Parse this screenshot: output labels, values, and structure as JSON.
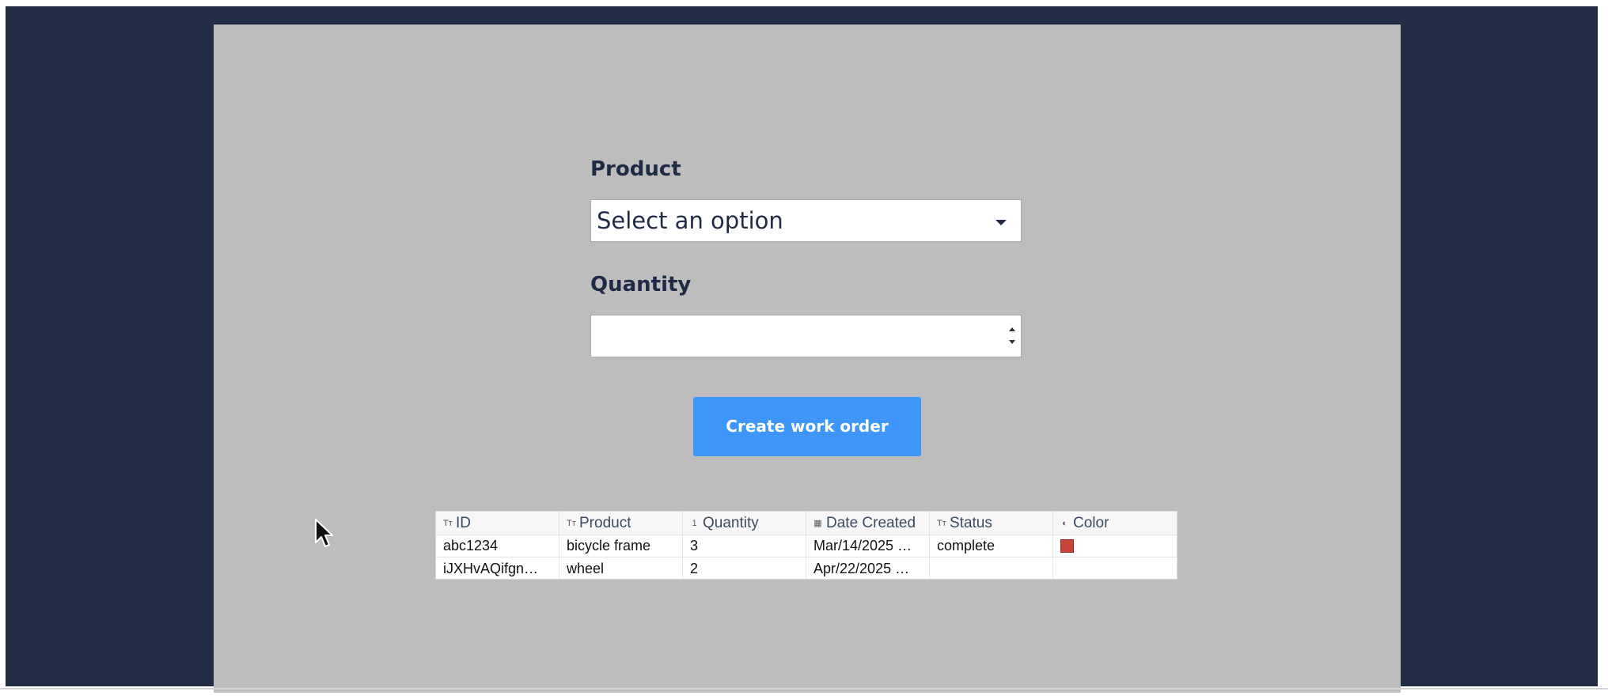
{
  "form": {
    "product_label": "Product",
    "product_select_value": "Select an option",
    "quantity_label": "Quantity",
    "quantity_value": "",
    "submit_label": "Create work order"
  },
  "table": {
    "columns": [
      {
        "label": "ID",
        "icon": "text-type-icon",
        "glyph": "Tт"
      },
      {
        "label": "Product",
        "icon": "text-type-icon",
        "glyph": "Tт"
      },
      {
        "label": "Quantity",
        "icon": "number-type-icon",
        "glyph": "1"
      },
      {
        "label": "Date Created",
        "icon": "calendar-type-icon",
        "glyph": "▦"
      },
      {
        "label": "Status",
        "icon": "text-type-icon",
        "glyph": "Tт"
      },
      {
        "label": "Color",
        "icon": "palette-type-icon",
        "glyph": "◐"
      }
    ],
    "rows": [
      {
        "id": "abc1234",
        "product": "bicycle frame",
        "quantity": "3",
        "date_created": "Mar/14/2025 …",
        "status": "complete",
        "color": "#c9433a"
      },
      {
        "id": "iJXHvAQifgn…",
        "product": "wheel",
        "quantity": "2",
        "date_created": "Apr/22/2025 …",
        "status": "",
        "color": ""
      }
    ]
  },
  "colors": {
    "frame": "#202d45",
    "canvas": "#bdbdbd",
    "button": "#3e97f8",
    "text_dark": "#1f2b44"
  }
}
